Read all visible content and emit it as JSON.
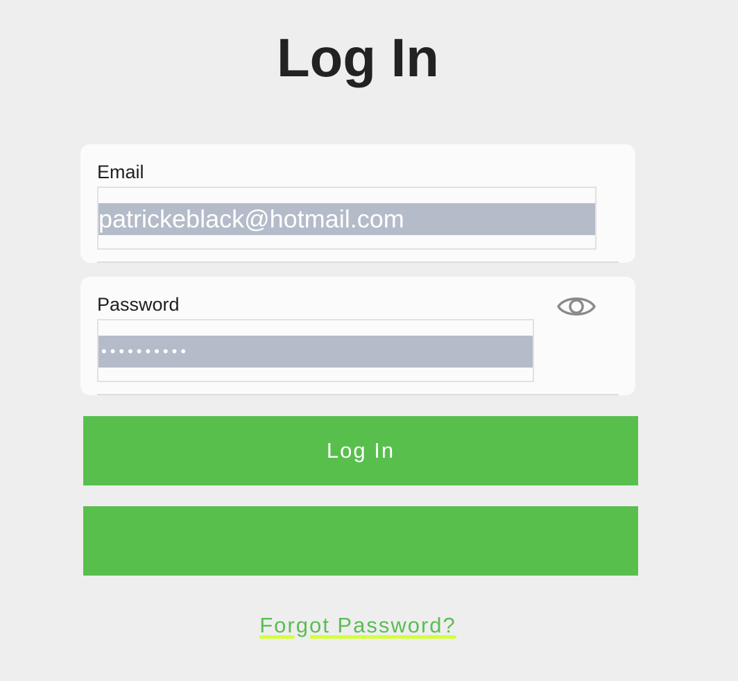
{
  "page": {
    "title": "Log In"
  },
  "email": {
    "label": "Email",
    "value": "patrickeblack@hotmail.com"
  },
  "password": {
    "label": "Password",
    "masked_value": "••••••••••",
    "toggle_icon": "eye-icon"
  },
  "buttons": {
    "login_label": "Log In",
    "second_label": ""
  },
  "links": {
    "forgot_password": "Forgot Password?"
  },
  "colors": {
    "background": "#eeeeee",
    "card": "#fbfbfb",
    "primary_button": "#58bf4d",
    "selection": "#b4bbc9",
    "link": "#5bbd52",
    "link_underline": "#d6ff3b"
  }
}
